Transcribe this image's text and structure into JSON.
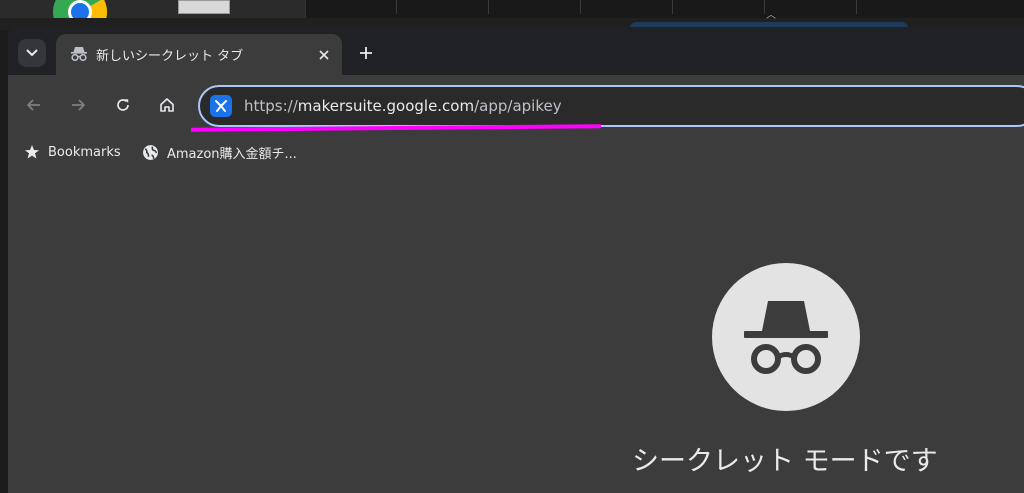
{
  "tab": {
    "title": "新しいシークレット タブ",
    "icon": "incognito-icon"
  },
  "omnibox": {
    "url_protocol": "https://",
    "url_domain": "makersuite.google.com",
    "url_path": "/app/apikey",
    "site_icon": "ai-studio-icon"
  },
  "bookmarks": {
    "items": [
      {
        "label": "Bookmarks",
        "icon": "star-icon"
      },
      {
        "label": "Amazon購入金額チ...",
        "icon": "globe-icon"
      }
    ]
  },
  "incognito_page": {
    "heading": "シークレット モードです"
  },
  "colors": {
    "omnibox_focus": "#a8c7fa",
    "annotation_underline": "#ff00ff",
    "background": "#3c3c3c"
  }
}
